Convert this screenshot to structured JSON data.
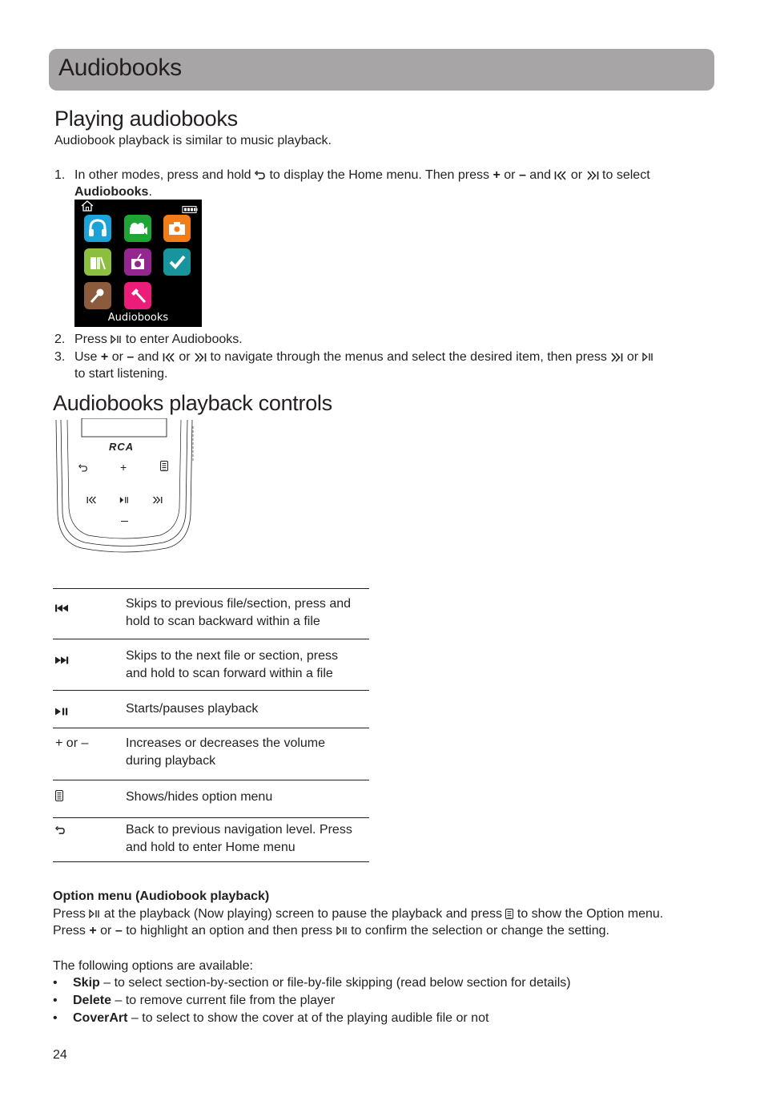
{
  "header": {
    "title": "Audiobooks"
  },
  "playing": {
    "heading": "Playing audiobooks",
    "intro": "Audiobook playback is similar to music playback.",
    "steps": [
      {
        "num": "1.",
        "parts": {
          "a": "In other modes, press and hold",
          "b": "to display the Home menu. Then press",
          "plus": "+",
          "or1": "or",
          "minus": "–",
          "and": "and",
          "or2": "or",
          "c": "to select",
          "bold": "Audiobooks",
          "end": "."
        }
      },
      {
        "num": "2.",
        "parts": {
          "a": "Press",
          "b": "to enter Audiobooks."
        }
      },
      {
        "num": "3.",
        "parts": {
          "a": "Use",
          "plus": "+",
          "or1": "or",
          "minus": "–",
          "and": "and",
          "or2": "or",
          "b": "to navigate through the menus and select the desired item, then press",
          "or3": "or",
          "c": "to start listening."
        }
      }
    ],
    "screen": {
      "label": "Audiobooks",
      "icons": [
        {
          "name": "music-icon",
          "color": "#1ba3d8"
        },
        {
          "name": "video-icon",
          "color": "#1fa535"
        },
        {
          "name": "photo-icon",
          "color": "#f07d1a"
        },
        {
          "name": "audiobooks-icon",
          "color": "#8cbf3f"
        },
        {
          "name": "radio-icon",
          "color": "#93278f"
        },
        {
          "name": "settings-check-icon",
          "color": "#17949c"
        },
        {
          "name": "recording-icon",
          "color": "#8c5a3c"
        },
        {
          "name": "tools-icon",
          "color": "#ec1d79"
        }
      ]
    }
  },
  "controls": {
    "heading": "Audiobooks playback controls",
    "device": {
      "brand": "RCA",
      "buttons": [
        "back",
        "volume-up",
        "menu",
        "previous",
        "play-pause",
        "next",
        "volume-down"
      ]
    },
    "table": [
      {
        "key_icon": "previous-icon",
        "desc_line1": "Skips to previous file/section, press and",
        "desc_line2": "hold to scan backward within a file"
      },
      {
        "key_icon": "next-icon",
        "desc_line1": "Skips to the next file or section, press",
        "desc_line2": "and hold to scan forward within a file"
      },
      {
        "key_icon": "play-pause-icon",
        "desc_line1": "Starts/pauses playback",
        "desc_line2": ""
      },
      {
        "key_text": "+ or –",
        "desc_line1": "Increases or decreases the volume",
        "desc_line2": "during playback"
      },
      {
        "key_icon": "menu-icon",
        "desc_line1": "Shows/hides option menu",
        "desc_line2": ""
      },
      {
        "key_icon": "back-icon",
        "desc_line1": "Back to previous navigation level. Press",
        "desc_line2": "and hold to enter Home menu"
      }
    ]
  },
  "option_menu": {
    "heading": "Option menu (Audiobook playback)",
    "line1": {
      "a": "Press",
      "b": "at the playback (Now playing) screen to pause the playback and press",
      "c": "to show the Option menu."
    },
    "line2": {
      "a": "Press",
      "plus": "+",
      "or": "or",
      "minus": "–",
      "b": "to highlight an option and then press",
      "c": "to confirm the selection or change the setting."
    },
    "available": "The following options are available:",
    "options": [
      {
        "bullet": "•",
        "term": "Skip",
        "desc": " – to select section-by-section or file-by-file skipping (read below section for details)"
      },
      {
        "bullet": "•",
        "term": "Delete",
        "desc": " – to remove current file from the player"
      },
      {
        "bullet": "•",
        "term": "CoverArt",
        "desc": " – to select to show the cover at of the playing audible file or not"
      }
    ]
  },
  "footer": {
    "page_number": "24"
  }
}
